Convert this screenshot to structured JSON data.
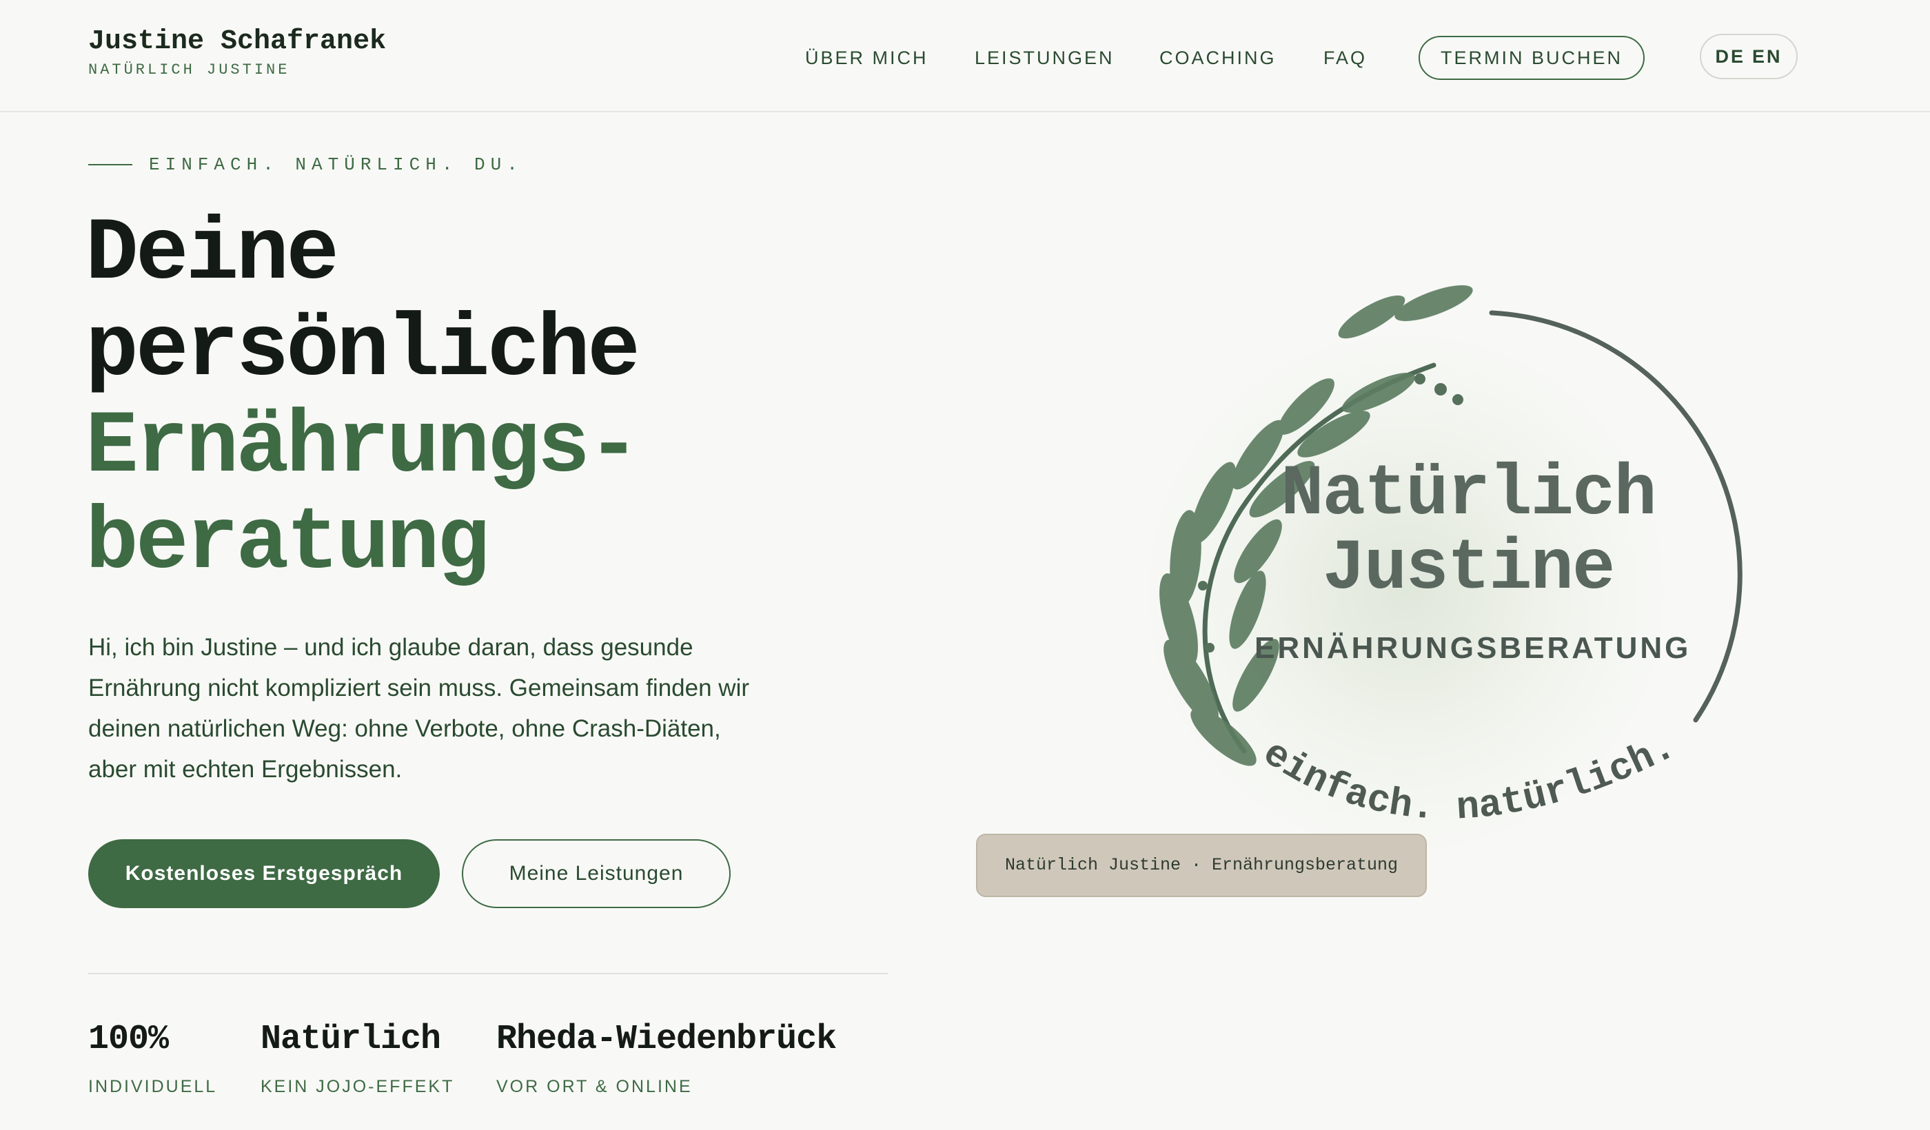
{
  "header": {
    "brand_name": "Justine Schafranek",
    "brand_sub": "NATÜRLICH JUSTINE",
    "nav": [
      {
        "label": "ÜBER MICH"
      },
      {
        "label": "LEISTUNGEN"
      },
      {
        "label": "COACHING"
      },
      {
        "label": "FAQ"
      }
    ],
    "cta_label": "TERMIN BUCHEN",
    "lang": {
      "de": "DE",
      "en": "EN"
    }
  },
  "hero": {
    "eyebrow": "EINFACH. NATÜRLICH. DU.",
    "headline_line1": "Deine",
    "headline_line2": "persönliche",
    "headline_line3": "Ernährungs-",
    "headline_line4": "beratung",
    "intro": "Hi, ich bin Justine – und ich glaube daran, dass gesunde Ernährung nicht kompliziert sein muss. Gemeinsam finden wir deinen natürlichen Weg: ohne Verbote, ohne Crash-Diäten, aber mit echten Ergebnissen.",
    "primary_button": "Kostenloses Erstgespräch",
    "secondary_button": "Meine Leistungen"
  },
  "stats": [
    {
      "value": "100%",
      "label": "INDIVIDUELL"
    },
    {
      "value": "Natürlich",
      "label": "KEIN JOJO-EFFEKT"
    },
    {
      "value": "Rheda-Wiedenbrück",
      "label": "VOR ORT & ONLINE"
    }
  ],
  "logo": {
    "title_line1": "Natürlich",
    "title_line2": "Justine",
    "subtitle": "ERNÄHRUNGSBERATUNG",
    "curved_text": "einfach. natürlich. du.",
    "caption": "Natürlich Justine · Ernährungsberatung"
  },
  "colors": {
    "accent": "#3e6a44",
    "text_dark": "#141a15",
    "background": "#f8f9f6",
    "caption_bg": "#cfc8ba"
  }
}
